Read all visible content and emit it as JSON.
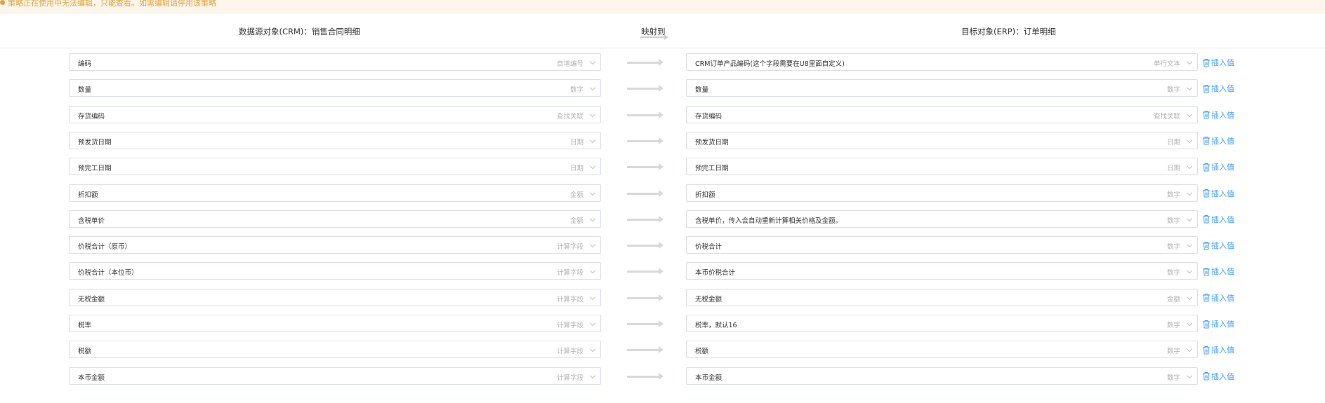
{
  "notice": "策略正在使用中无法编辑，只能查看。如需编辑请停用该策略",
  "header": {
    "source": "数据源对象(CRM)：销售合同明细",
    "mapping": "映射到",
    "target": "目标对象(ERP)：订单明细"
  },
  "insert_label": "插入值",
  "colors": {
    "notice_bg": "#fdf6ec",
    "notice_text": "#e6a23c",
    "link": "#409eff",
    "border": "#dcdfe6"
  },
  "icons": {
    "chevron": "chevron-down-icon",
    "arrow": "arrow-right-icon",
    "trash": "trash-icon"
  },
  "rows": [
    {
      "src": "编码",
      "src_type": "自增编号",
      "dst": "CRM订单产品编码(这个字段需要在U8里面自定义)",
      "dst_type": "单行文本"
    },
    {
      "src": "数量",
      "src_type": "数字",
      "dst": "数量",
      "dst_type": "数字"
    },
    {
      "src": "存货编码",
      "src_type": "查找关联",
      "dst": "存货编码",
      "dst_type": "查找关联"
    },
    {
      "src": "预发货日期",
      "src_type": "日期",
      "dst": "预发货日期",
      "dst_type": "日期"
    },
    {
      "src": "预完工日期",
      "src_type": "日期",
      "dst": "预完工日期",
      "dst_type": "日期"
    },
    {
      "src": "折扣额",
      "src_type": "金额",
      "dst": "折扣额",
      "dst_type": "数字"
    },
    {
      "src": "含税单价",
      "src_type": "金额",
      "dst": "含税单价，传入会自动重新计算相关价格及金额。",
      "dst_type": "数字"
    },
    {
      "src": "价税合计（原币）",
      "src_type": "计算字段",
      "dst": "价税合计",
      "dst_type": "数字"
    },
    {
      "src": "价税合计（本位币）",
      "src_type": "计算字段",
      "dst": "本币价税合计",
      "dst_type": "数字"
    },
    {
      "src": "无税金额",
      "src_type": "计算字段",
      "dst": "无税金额",
      "dst_type": "金额"
    },
    {
      "src": "税率",
      "src_type": "计算字段",
      "dst": "税率，默认16",
      "dst_type": "数字"
    },
    {
      "src": "税额",
      "src_type": "计算字段",
      "dst": "税额",
      "dst_type": "数字"
    },
    {
      "src": "本币金额",
      "src_type": "计算字段",
      "dst": "本币金额",
      "dst_type": "数字"
    }
  ]
}
